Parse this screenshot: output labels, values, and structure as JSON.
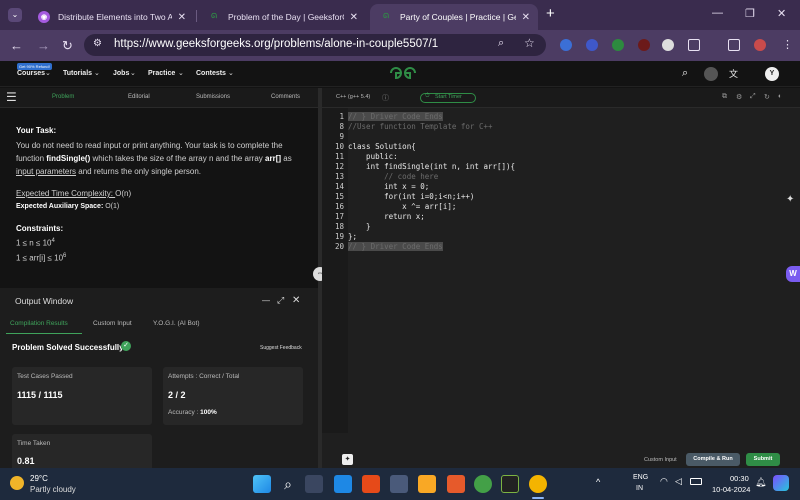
{
  "browser": {
    "tabs": [
      {
        "title": "Distribute Elements into Two Array"
      },
      {
        "title": "Problem of the Day | GeeksforGee"
      },
      {
        "title": "Party of Couples | Practice | Geeksf"
      }
    ],
    "new_tab": "+",
    "url": "https://www.geeksforgeeks.org/problems/alone-in-couple5507/1"
  },
  "gfg_header": {
    "badge": "Get 90% Refund!",
    "menu": [
      "Courses",
      "Tutorials",
      "Jobs",
      "Practice",
      "Contests"
    ],
    "avatar": "Y"
  },
  "left_tabs": [
    "Problem",
    "Editorial",
    "Submissions",
    "Comments"
  ],
  "problem": {
    "your_task_heading": "Your Task:",
    "task_p1": "You do not need to read input or print anything. Your task is to complete the function ",
    "task_fn": "findSingle()",
    "task_p2": " which takes the size of the array n and the array ",
    "task_arr": "arr[]",
    "task_p3": " as ",
    "task_ip": "input parameters",
    "task_p4": " and returns the only single person.",
    "time_label": "Expected Time Complexity: ",
    "time_val": "O(n)",
    "space_label": "Expected Auxiliary Space: ",
    "space_val": "O(1)",
    "constraints_heading": "Constraints:",
    "c1_pre": "1 ≤ n ≤ 10",
    "c1_sup": "4",
    "c2_pre": "1 ≤ arr[i] ≤ 10",
    "c2_sup": "6"
  },
  "output_window": {
    "title": "Output Window",
    "tabs": [
      "Compilation Results",
      "Custom Input",
      "Y.O.G.I. (AI Bot)"
    ],
    "status": "Problem Solved Successfully",
    "feedback": "Suggest Feedback",
    "test_cases_label": "Test Cases Passed",
    "test_cases_value": "1115 / 1115",
    "attempts_label": "Attempts : Correct / Total",
    "attempts_value": "2 / 2",
    "accuracy_label": "Accuracy :",
    "accuracy_value": "100%",
    "time_label": "Time Taken",
    "time_value": "0.81"
  },
  "editor": {
    "language": "C++ (g++ 5.4)",
    "start_timer": "Start Timer",
    "line_numbers": [
      "1",
      "8",
      "9",
      "10",
      "11",
      "12",
      "13",
      "14",
      "15",
      "16",
      "17",
      "18",
      "19",
      "20"
    ],
    "code_lines": [
      "// } Driver Code Ends",
      "//User function Template for C++",
      "",
      "class Solution{",
      "    public:",
      "    int findSingle(int n, int arr[]){",
      "        // code here",
      "        int x = 0;",
      "        for(int i=0;i<n;i++)",
      "            x ^= arr[i];",
      "        return x;",
      "    }",
      "};",
      "// } Driver Code Ends"
    ],
    "custom_input": "Custom Input",
    "compile_run": "Compile & Run",
    "submit": "Submit"
  },
  "taskbar": {
    "temp": "29°C",
    "weather": "Partly cloudy",
    "lang1": "ENG",
    "lang2": "IN",
    "time": "00:30",
    "date": "10-04-2024"
  },
  "colors": {
    "gfg_green": "#2f8d46",
    "submit_green": "#2f8d46",
    "browser_tab": "#3a2c4e"
  }
}
